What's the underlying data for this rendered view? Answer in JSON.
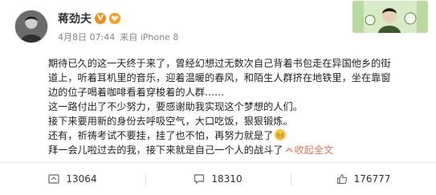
{
  "post": {
    "author": "蒋劲夫",
    "verified_badge": "V",
    "date": "4月8日 07:44",
    "source": "来自 iPhone 8",
    "content_lines": [
      "期待已久的这一天终于来了，曾经幻想过无数次自己背着书包走在异国他乡的街",
      "道上，听着耳机里的音乐，迎着温暖的春风，和陌生人群挤在地铁里，坐在靠窗",
      "边的位子喝着咖啡看着穿梭着的人群……",
      "这一路付出了不少努力，要感谢助我实现这个梦想的人们。",
      "接下来要用新的身份去呼吸空气，大口吃饭，狠狠锻炼。",
      "还有，祈祷考试不要挂，挂了也不怕，再努力就是了",
      "拜一会儿啦过去的我，接下来就是自己一个人的战斗了"
    ],
    "collapse_label": "收起全文",
    "actions": {
      "forward_count": "13064",
      "comment_count": "18310",
      "like_count": "176777"
    },
    "icons": {
      "verified": "verified-v-icon",
      "member": "heart-badge-icon",
      "emoji": "grin-emoji-icon",
      "collapse": "collapse-arrow-icon",
      "forward": "forward-icon",
      "comment": "comment-icon",
      "like": "thumbs-up-icon"
    },
    "colors": {
      "link": "#eb7350",
      "verified": "#f08d1a",
      "meta_text": "#888888"
    }
  }
}
